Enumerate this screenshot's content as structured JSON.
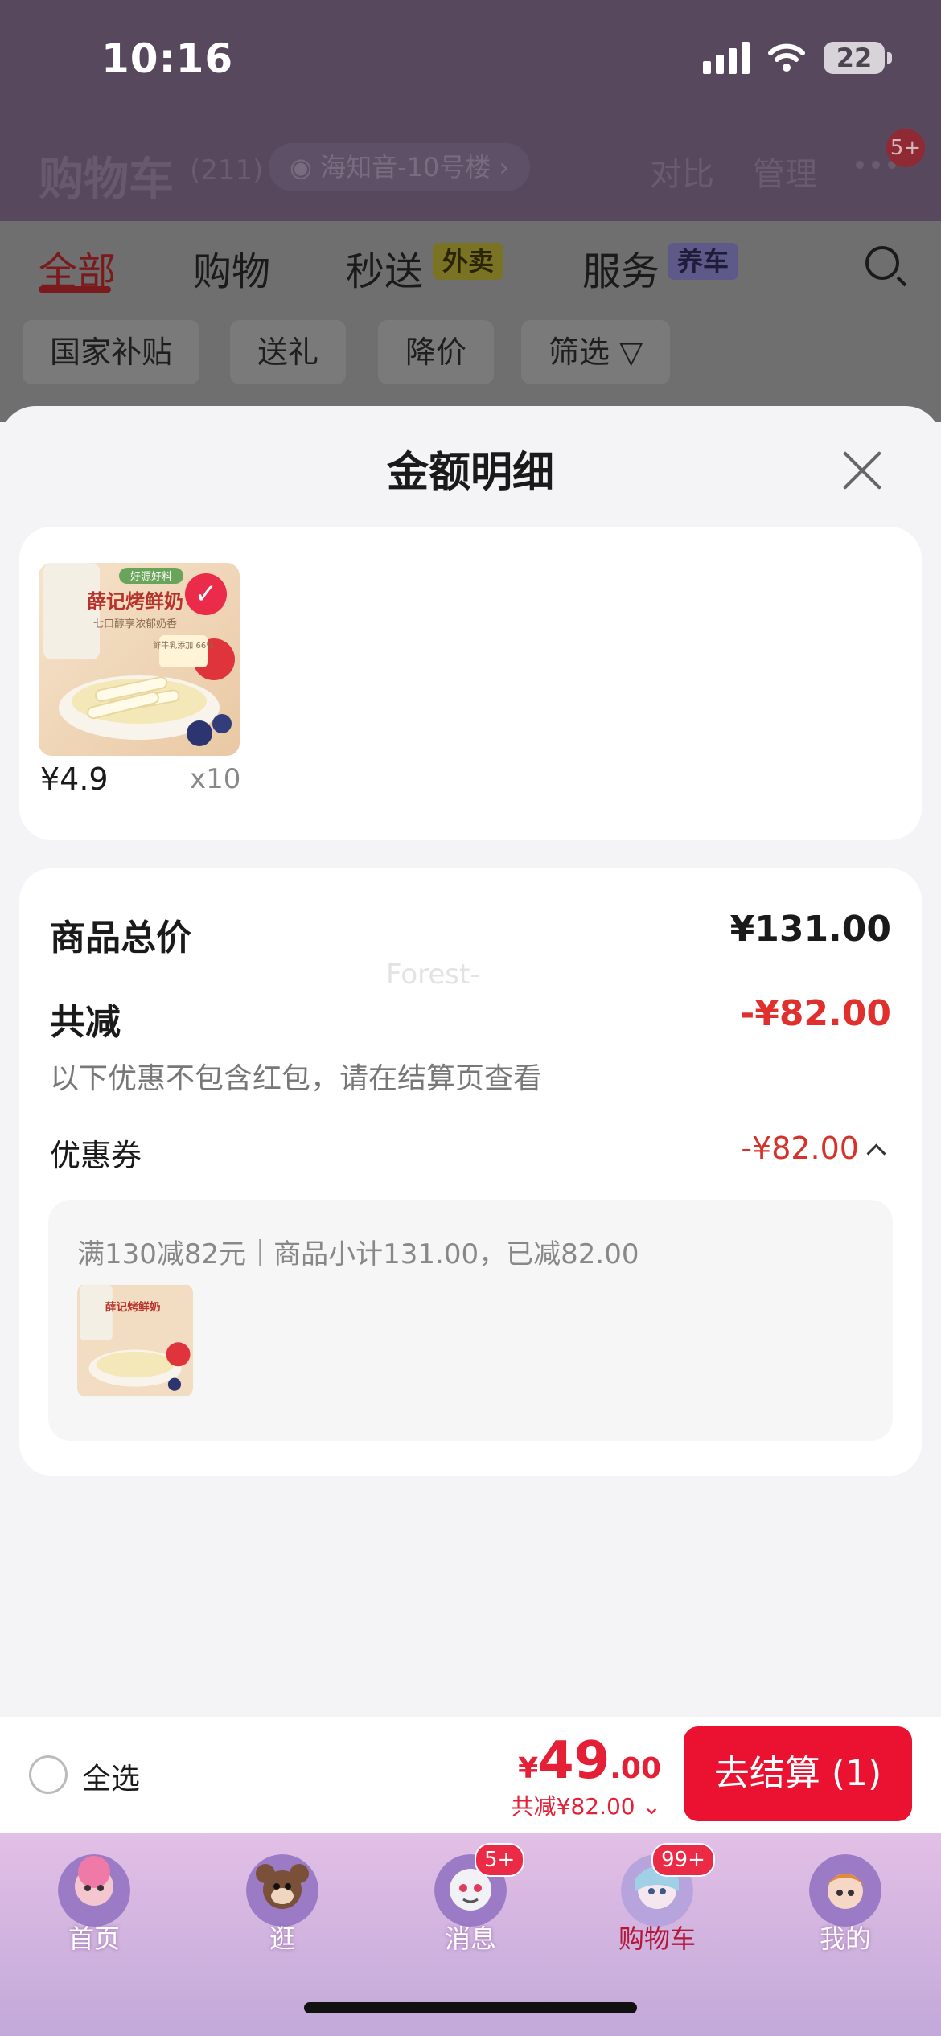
{
  "status_bar": {
    "time": "10:16",
    "battery": "22"
  },
  "cart_header": {
    "title": "购物车",
    "count": "(211)",
    "address": "海知音-10号楼",
    "compare": "对比",
    "manage": "管理",
    "more_badge": "5+"
  },
  "tabs": [
    {
      "label": "全部",
      "active": true
    },
    {
      "label": "购物"
    },
    {
      "label": "秒送",
      "tag": "外卖"
    },
    {
      "label": "服务",
      "tag": "养车"
    }
  ],
  "filter_chips": [
    "国家补贴",
    "送礼",
    "降价",
    "筛选"
  ],
  "sheet": {
    "title": "金额明细",
    "product": {
      "price": "¥4.9",
      "qty": "x10",
      "brand_text": "薛记烤鲜奶",
      "tag_text": "好源好料",
      "sub_text": "七口醇享浓郁奶香",
      "ratio": "鲜牛乳添加 66%"
    },
    "summary": {
      "total_label": "商品总价",
      "total_value": "¥131.00",
      "discount_label": "共减",
      "discount_value": "-¥82.00",
      "note": "以下优惠不包含红包，请在结算页查看",
      "coupon_label": "优惠券",
      "coupon_value": "-¥82.00",
      "coupon_desc": "满130减82元｜商品小计131.00，已减82.00"
    },
    "watermark": "Forest-"
  },
  "checkout": {
    "select_all": "全选",
    "price_symbol": "¥",
    "price_int": "49",
    "price_dec": ".00",
    "discount": "共减¥82.00",
    "button": "去结算 (1)"
  },
  "tabbar": [
    {
      "label": "首页"
    },
    {
      "label": "逛"
    },
    {
      "label": "消息",
      "badge": "5+"
    },
    {
      "label": "购物车",
      "badge": "99+",
      "active": true
    },
    {
      "label": "我的"
    }
  ],
  "colors": {
    "accent": "#eb1231",
    "price_red": "#e51f36",
    "sheet_bg": "#f4f3f5"
  }
}
